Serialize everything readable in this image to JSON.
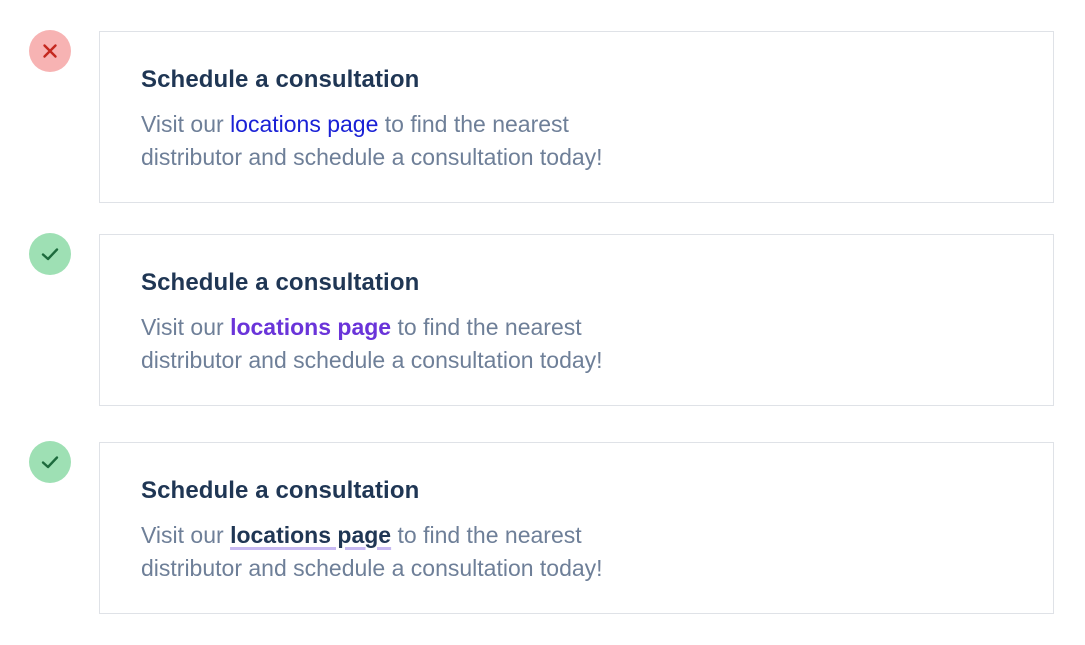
{
  "colors": {
    "bad_circle": "#f7b3b3",
    "bad_mark": "#c4281f",
    "good_circle": "#9ee0b4",
    "good_mark": "#1d6b3d",
    "title": "#1f3654",
    "body": "#6e7f98",
    "link_default": "#1a21d6",
    "link_bold": "#6a34d9",
    "link_underline": "#c7b9f2"
  },
  "examples": [
    {
      "status_icon": "close-icon",
      "title": "Schedule a consultation",
      "text_before": "Visit our ",
      "link_text": "locations page",
      "text_after": " to find the nearest",
      "text_line2": "distributor and schedule a consultation today!"
    },
    {
      "status_icon": "check-icon",
      "title": "Schedule a consultation",
      "text_before": "Visit our ",
      "link_text": "locations page",
      "text_after": " to find the nearest",
      "text_line2": "distributor and schedule a consultation today!"
    },
    {
      "status_icon": "check-icon",
      "title": "Schedule a consultation",
      "text_before": "Visit our ",
      "link_text": "locations page",
      "text_after": " to find the nearest",
      "text_line2": "distributor and schedule a consultation today!"
    }
  ]
}
